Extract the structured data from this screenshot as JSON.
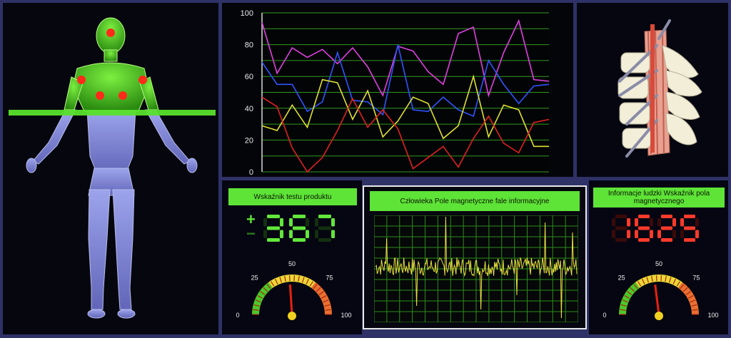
{
  "body_scan": {
    "points": [
      {
        "name": "head"
      },
      {
        "name": "left-shoulder"
      },
      {
        "name": "right-shoulder"
      },
      {
        "name": "left-chest"
      },
      {
        "name": "right-chest"
      }
    ]
  },
  "chart_data": {
    "type": "line",
    "x": [
      0,
      1,
      2,
      3,
      4,
      5,
      6,
      7,
      8,
      9,
      10,
      11,
      12,
      13,
      14,
      15,
      16,
      17,
      18,
      19
    ],
    "ylim": [
      0,
      100
    ],
    "yticks": [
      "0",
      "20",
      "40",
      "60",
      "80",
      "100"
    ],
    "grid": true,
    "series": [
      {
        "color": "#e040e0",
        "values": [
          94,
          62,
          78,
          72,
          77,
          68,
          78,
          66,
          48,
          79,
          76,
          63,
          55,
          87,
          91,
          48,
          75,
          95,
          58,
          57
        ]
      },
      {
        "color": "#2e55ff",
        "values": [
          69,
          55,
          55,
          38,
          44,
          75,
          45,
          44,
          36,
          80,
          39,
          38,
          47,
          39,
          35,
          70,
          55,
          43,
          54,
          55
        ]
      },
      {
        "color": "#e0e030",
        "values": [
          29,
          26,
          42,
          28,
          58,
          56,
          33,
          51,
          22,
          32,
          47,
          43,
          21,
          29,
          60,
          22,
          42,
          39,
          16,
          16
        ]
      },
      {
        "color": "#e02020",
        "values": [
          47,
          41,
          15,
          0,
          9,
          26,
          46,
          28,
          39,
          27,
          2,
          9,
          16,
          3,
          21,
          35,
          18,
          12,
          31,
          33
        ]
      }
    ]
  },
  "product_test": {
    "title": "Wskaźnik testu produktu",
    "plus": "+",
    "minus": "−",
    "display": "367",
    "gauge_value": 48,
    "gauge_labels": {
      "min": "0",
      "q1": "25",
      "mid": "50",
      "q3": "75",
      "max": "100"
    }
  },
  "wave": {
    "title": "Człowieka Pole magnetyczne fale informacyjne",
    "color": "#e8e040"
  },
  "human_field": {
    "title": "Informacje ludzki Wskaźnik pola magnetycznego",
    "display": "1625",
    "gauge_value": 46,
    "gauge_labels": {
      "min": "0",
      "q1": "25",
      "mid": "50",
      "q3": "75",
      "max": "100"
    }
  }
}
